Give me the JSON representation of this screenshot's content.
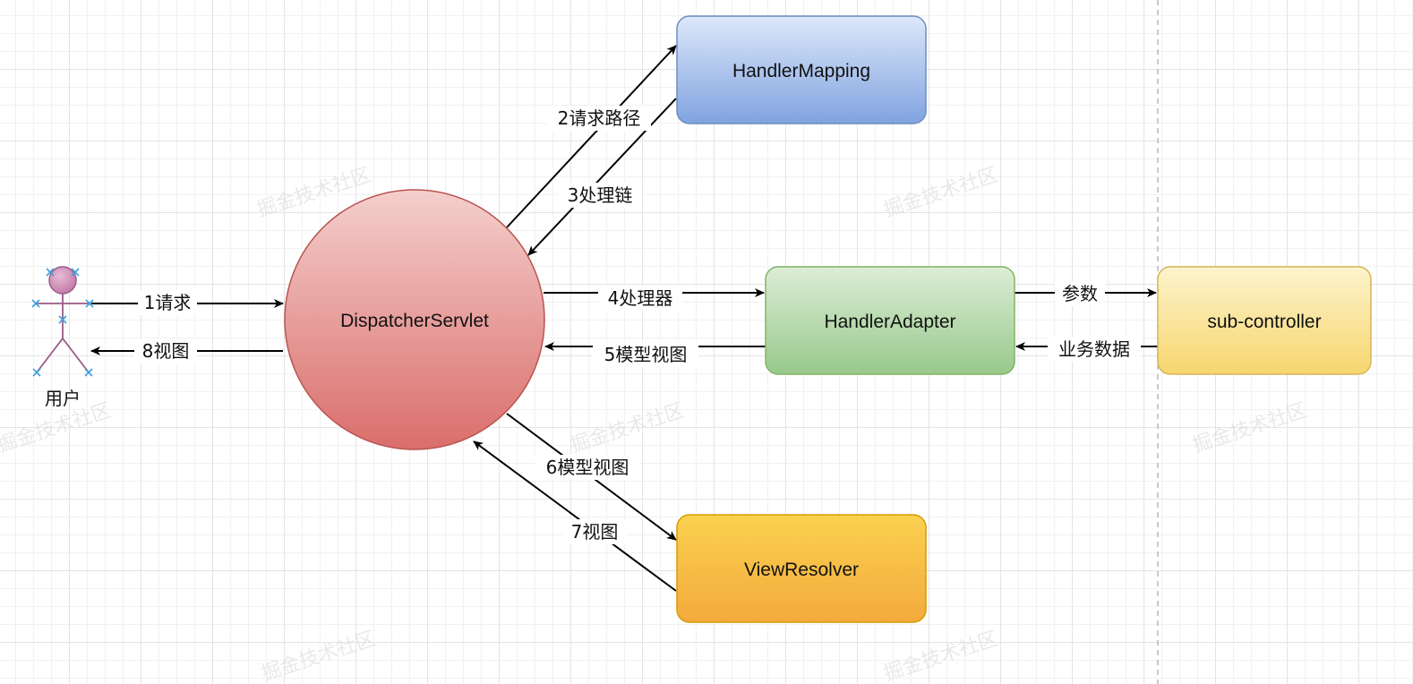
{
  "nodes": {
    "dispatcher": "DispatcherServlet",
    "handler_mapping": "HandlerMapping",
    "handler_adapter": "HandlerAdapter",
    "view_resolver": "ViewResolver",
    "sub_controller": "sub-controller"
  },
  "actor": {
    "label": "用户"
  },
  "edges": {
    "e1": "1请求",
    "e2": "2请求路径",
    "e3": "3处理链",
    "e4": "4处理器",
    "e5": "5模型视图",
    "e6": "6模型视图",
    "e7": "7视图",
    "e8": "8视图",
    "params": "参数",
    "business_data": "业务数据"
  },
  "colors": {
    "dispatcher": [
      "#f4cfcd",
      "#da6e6b"
    ],
    "handler_mapping": [
      "#dde8fb",
      "#80a3df"
    ],
    "handler_adapter": [
      "#dcedd6",
      "#98c98b"
    ],
    "view_resolver": [
      "#fbd150",
      "#f3aa3c"
    ],
    "sub_controller": [
      "#fdf4cd",
      "#f7d66f"
    ]
  }
}
